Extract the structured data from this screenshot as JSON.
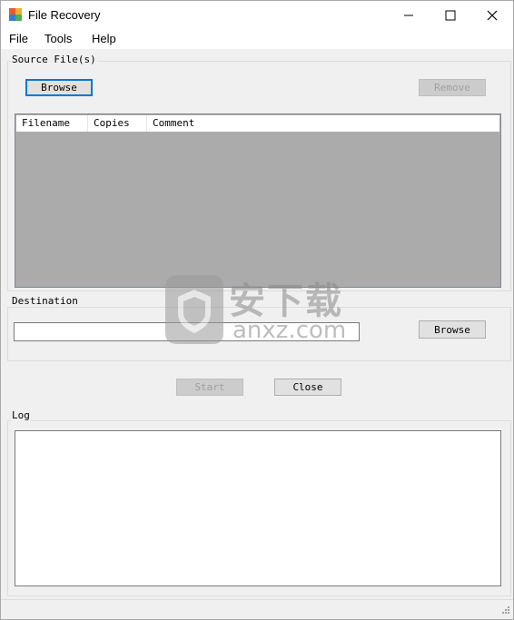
{
  "window": {
    "title": "File Recovery",
    "controls": {
      "minimize": "—",
      "maximize": "☐",
      "close": "✕"
    }
  },
  "menu": {
    "items": [
      "File",
      "Tools",
      "Help"
    ]
  },
  "source": {
    "group_label": "Source File(s)",
    "browse_label": "Browse",
    "remove_label": "Remove",
    "columns": [
      "Filename",
      "Copies",
      "Comment"
    ]
  },
  "destination": {
    "group_label": "Destination",
    "path_value": "",
    "browse_label": "Browse"
  },
  "actions": {
    "start_label": "Start",
    "close_label": "Close"
  },
  "log": {
    "group_label": "Log",
    "content": ""
  },
  "watermark": {
    "text": "anxz.com",
    "cn_text": "安下载"
  },
  "colors": {
    "accent": "#0078d7",
    "list_bg": "#ababab",
    "window_bg": "#f0f0f0"
  }
}
